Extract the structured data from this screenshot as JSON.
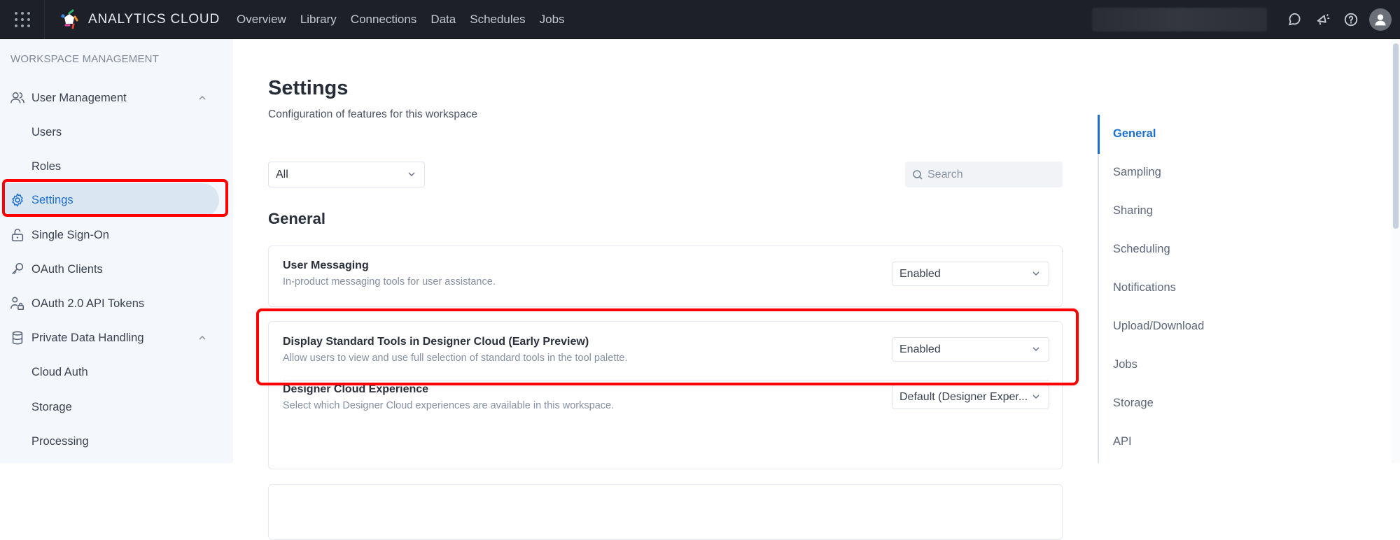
{
  "topbar": {
    "app_name": "ANALYTICS CLOUD",
    "nav": [
      "Overview",
      "Library",
      "Connections",
      "Data",
      "Schedules",
      "Jobs"
    ],
    "icons": [
      "apps-grid-icon",
      "chat-icon",
      "announcement-icon",
      "help-icon",
      "user-avatar-icon"
    ]
  },
  "sidebar": {
    "section_title": "WORKSPACE MANAGEMENT",
    "items": [
      {
        "label": "User Management",
        "icon": "users-icon",
        "expandable": true
      },
      {
        "label": "Users",
        "sub": true
      },
      {
        "label": "Roles",
        "sub": true
      },
      {
        "label": "Settings",
        "icon": "gear-icon",
        "active": true
      },
      {
        "label": "Single Sign-On",
        "icon": "unlock-icon"
      },
      {
        "label": "OAuth Clients",
        "icon": "key-icon"
      },
      {
        "label": "OAuth 2.0 API Tokens",
        "icon": "user-lock-icon"
      },
      {
        "label": "Private Data Handling",
        "icon": "database-icon",
        "expandable": true
      },
      {
        "label": "Cloud Auth",
        "sub": true
      },
      {
        "label": "Storage",
        "sub": true
      },
      {
        "label": "Processing",
        "sub": true
      }
    ]
  },
  "main": {
    "title": "Settings",
    "subtitle": "Configuration of features for this workspace",
    "filter_value": "All",
    "search_placeholder": "Search",
    "section_title": "General",
    "settings": [
      {
        "title": "User Messaging",
        "description": "In-product messaging tools for user assistance.",
        "value": "Enabled"
      },
      {
        "title": "Display Standard Tools in Designer Cloud (Early Preview)",
        "description": "Allow users to view and use full selection of standard tools in the tool palette.",
        "value": "Enabled"
      },
      {
        "title": "Designer Cloud Experience",
        "description": "Select which Designer Cloud experiences are available in this workspace.",
        "value": "Default (Designer Exper..."
      }
    ]
  },
  "anchor_nav": {
    "items": [
      "General",
      "Sampling",
      "Sharing",
      "Scheduling",
      "Notifications",
      "Upload/Download",
      "Jobs",
      "Storage",
      "API"
    ],
    "active": "General"
  },
  "colors": {
    "accent": "#1a6fd1",
    "topbar_bg": "#1d2028",
    "sidebar_bg": "#f4f7fb",
    "highlight": "#ff0000"
  }
}
